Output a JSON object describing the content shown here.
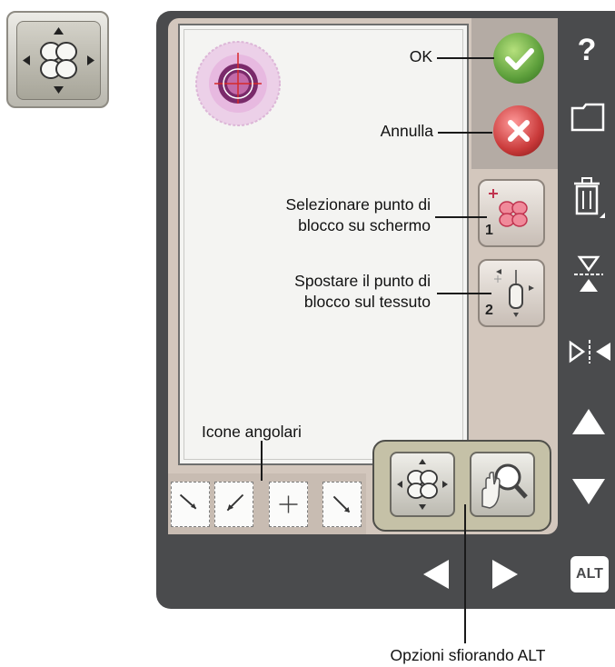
{
  "annotations": {
    "ok": "OK",
    "cancel": "Annulla",
    "select_point_line1": "Selezionare punto di",
    "select_point_line2": "blocco su schermo",
    "move_point_line1": "Spostare il punto di",
    "move_point_line2": "blocco sul tessuto",
    "corner_icons": "Icone angolari",
    "alt_options": "Opzioni sfiorando ALT"
  },
  "side_buttons": {
    "alt_label": "ALT",
    "select_step": "1",
    "move_step": "2"
  },
  "icons": {
    "help": "question-icon",
    "open": "folder-icon",
    "delete": "trash-icon",
    "flip_vertical": "flip-vertical-icon",
    "flip_horizontal": "flip-horizontal-icon",
    "up": "arrow-up-icon",
    "down": "arrow-down-icon",
    "left": "arrow-left-icon",
    "right": "arrow-right-icon"
  },
  "colors": {
    "device_frame": "#4a4b4d",
    "screen_bg": "#d3c7bd",
    "ok_green": "#5ea03c",
    "cancel_red": "#c93a3a",
    "embroidery_pink": "#e7b9e0",
    "embroidery_purple": "#7a2a6a"
  }
}
